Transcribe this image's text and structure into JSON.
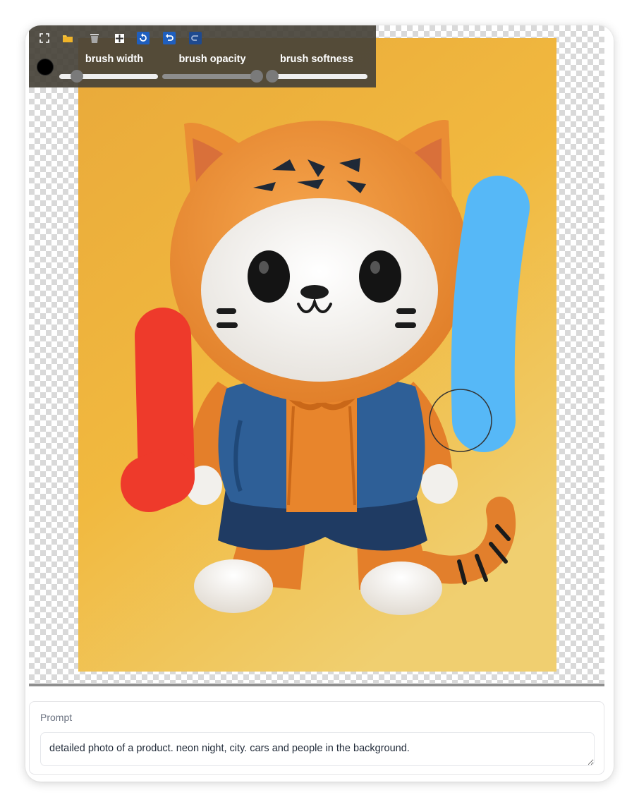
{
  "toolbar": {
    "icons": [
      "fullscreen-icon",
      "folder-icon",
      "trash-icon",
      "move-icon",
      "reset-icon",
      "undo-icon",
      "redo-icon"
    ],
    "brush_color": "#000000",
    "sliders": [
      {
        "label": "brush width",
        "value": 0.18
      },
      {
        "label": "brush opacity",
        "value": 1.0
      },
      {
        "label": "brush softness",
        "value": 0.0
      }
    ]
  },
  "canvas": {
    "strokes": [
      {
        "color": "#ee3a2b",
        "name": "red"
      },
      {
        "color": "#56b8f7",
        "name": "blue"
      }
    ]
  },
  "prompt": {
    "label": "Prompt",
    "value": "detailed photo of a product. neon night, city. cars and people in the background."
  },
  "colors": {
    "toolbar_bg": "#464238",
    "tool_button_accent": "#1f5fbf",
    "canvas_bg": "#f0b439"
  }
}
